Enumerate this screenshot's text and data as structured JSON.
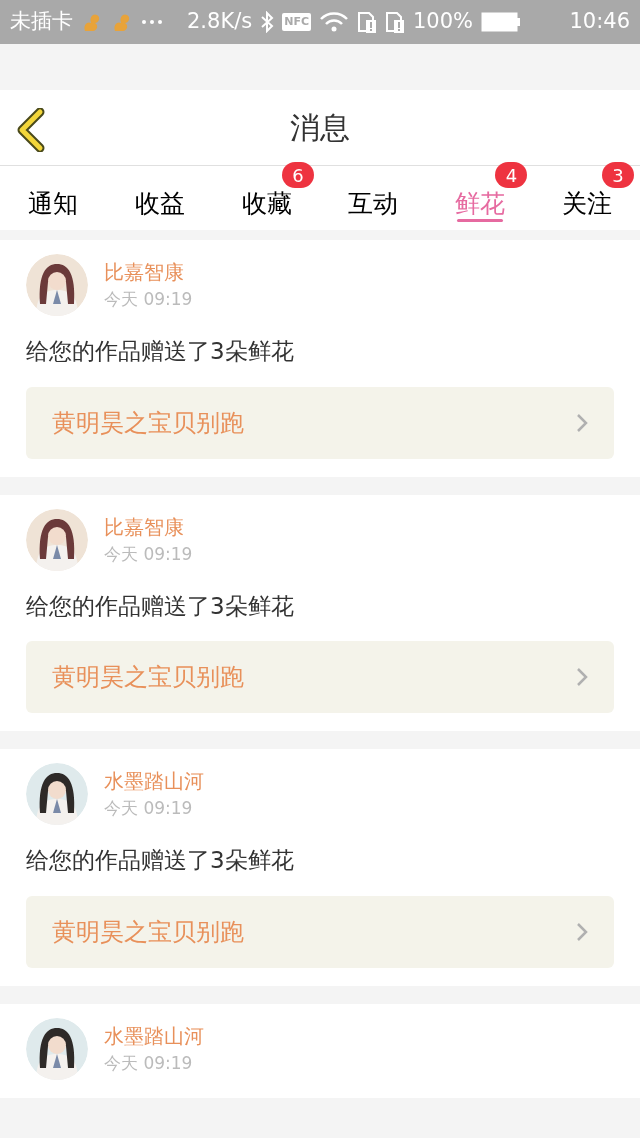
{
  "status_bar": {
    "carrier": "未插卡",
    "speed": "2.8K/s",
    "nfc": "NFC",
    "battery": "100%",
    "time": "10:46"
  },
  "header": {
    "title": "消息"
  },
  "tabs": [
    {
      "label": "通知",
      "selected": false
    },
    {
      "label": "收益",
      "selected": false
    },
    {
      "label": "收藏",
      "selected": false,
      "badge": "6"
    },
    {
      "label": "互动",
      "selected": false
    },
    {
      "label": "鲜花",
      "selected": true,
      "badge": "4"
    },
    {
      "label": "关注",
      "selected": false,
      "badge": "3"
    }
  ],
  "messages": [
    {
      "user": "比嘉智康",
      "time": "今天 09:19",
      "text": "给您的作品赠送了3朵鲜花",
      "work": "黄明昊之宝贝别跑"
    },
    {
      "user": "比嘉智康",
      "time": "今天 09:19",
      "text": "给您的作品赠送了3朵鲜花",
      "work": "黄明昊之宝贝别跑"
    },
    {
      "user": "水墨踏山河",
      "time": "今天 09:19",
      "text": "给您的作品赠送了3朵鲜花",
      "work": "黄明昊之宝贝别跑"
    },
    {
      "user": "水墨踏山河",
      "time": "今天 09:19"
    }
  ]
}
